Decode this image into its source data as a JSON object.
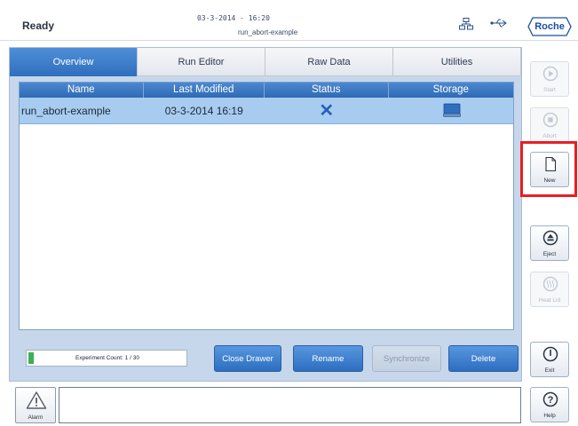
{
  "header": {
    "status": "Ready",
    "datetime": "03-3-2014 - 16:20",
    "run_name": "run_abort-example",
    "logo_text": "Roche",
    "network_icon": "network-icon",
    "usb_icon": "usb-icon"
  },
  "tabs": [
    {
      "label": "Overview",
      "active": true
    },
    {
      "label": "Run Editor",
      "active": false
    },
    {
      "label": "Raw Data",
      "active": false
    },
    {
      "label": "Utilities",
      "active": false
    }
  ],
  "table": {
    "columns": [
      "Name",
      "Last Modified",
      "Status",
      "Storage"
    ],
    "rows": [
      {
        "name": "run_abort-example",
        "last_modified": "03-3-2014 16:19",
        "status_icon": "cross-icon",
        "storage_icon": "drive-icon"
      }
    ]
  },
  "bottom": {
    "experiment_count_label": "Experiment Count: 1 / 30",
    "experiment_count_fraction": 0.033,
    "close_drawer": "Close Drawer",
    "rename": "Rename",
    "synchronize": "Synchronize",
    "delete": "Delete"
  },
  "side": {
    "start": "Start",
    "abort": "Abort",
    "new": "New",
    "eject": "Eject",
    "heat_lid": "Heat Lid",
    "exit": "Exit",
    "help": "Help"
  },
  "alarm": {
    "label": "Alarm",
    "message": ""
  },
  "colors": {
    "accent": "#2e6fbe",
    "selected_row": "#a7ccf0",
    "highlight": "#e81e24",
    "panel": "#c6d7eb"
  }
}
